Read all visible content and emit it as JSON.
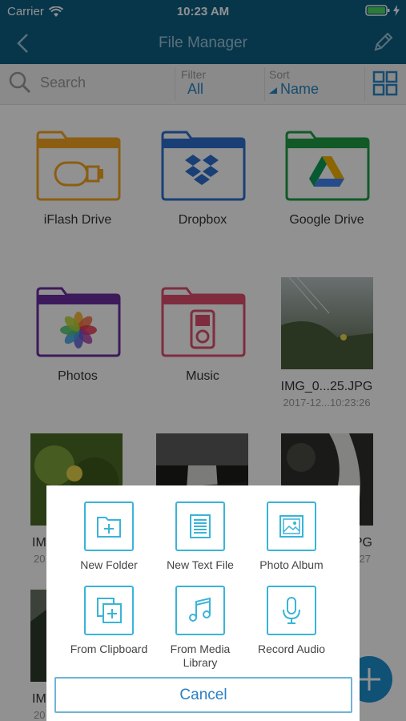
{
  "status_bar": {
    "carrier": "Carrier",
    "time": "10:23 AM"
  },
  "nav": {
    "title": "File Manager"
  },
  "toolbar": {
    "search_placeholder": "Search",
    "filter_label": "Filter",
    "filter_value": "All",
    "sort_label": "Sort",
    "sort_value": "Name"
  },
  "grid_items": [
    {
      "name": "iFlash Drive",
      "icon": "usb-drive-icon",
      "color": "#f5a623"
    },
    {
      "name": "Dropbox",
      "icon": "dropbox-icon",
      "color": "#2f6fd0"
    },
    {
      "name": "Google Drive",
      "icon": "google-drive-icon",
      "color": "#1e9e45"
    },
    {
      "name": "Photos",
      "icon": "photos-icon",
      "color": "#6b2fa0"
    },
    {
      "name": "Music",
      "icon": "music-player-icon",
      "color": "#e0506e"
    },
    {
      "name": "IMG_0...25.JPG",
      "date": "2017-12...10:23:26"
    },
    {
      "name": "IM",
      "date": "20"
    },
    {
      "name": "",
      "date": ""
    },
    {
      "name": "PG",
      "date": "27"
    },
    {
      "name": "IM",
      "date": "20"
    }
  ],
  "sheet": {
    "actions": [
      {
        "label": "New Folder",
        "icon": "new-folder-icon"
      },
      {
        "label": "New Text File",
        "icon": "text-file-icon"
      },
      {
        "label": "Photo Album",
        "icon": "photo-album-icon"
      },
      {
        "label": "From Clipboard",
        "icon": "clipboard-icon"
      },
      {
        "label": "From Media Library",
        "icon": "music-note-icon"
      },
      {
        "label": "Record Audio",
        "icon": "microphone-icon"
      }
    ],
    "cancel_label": "Cancel"
  },
  "colors": {
    "nav_bg": "#0e5f84",
    "accent": "#2a86c6",
    "icon_border": "#39b4d8"
  }
}
